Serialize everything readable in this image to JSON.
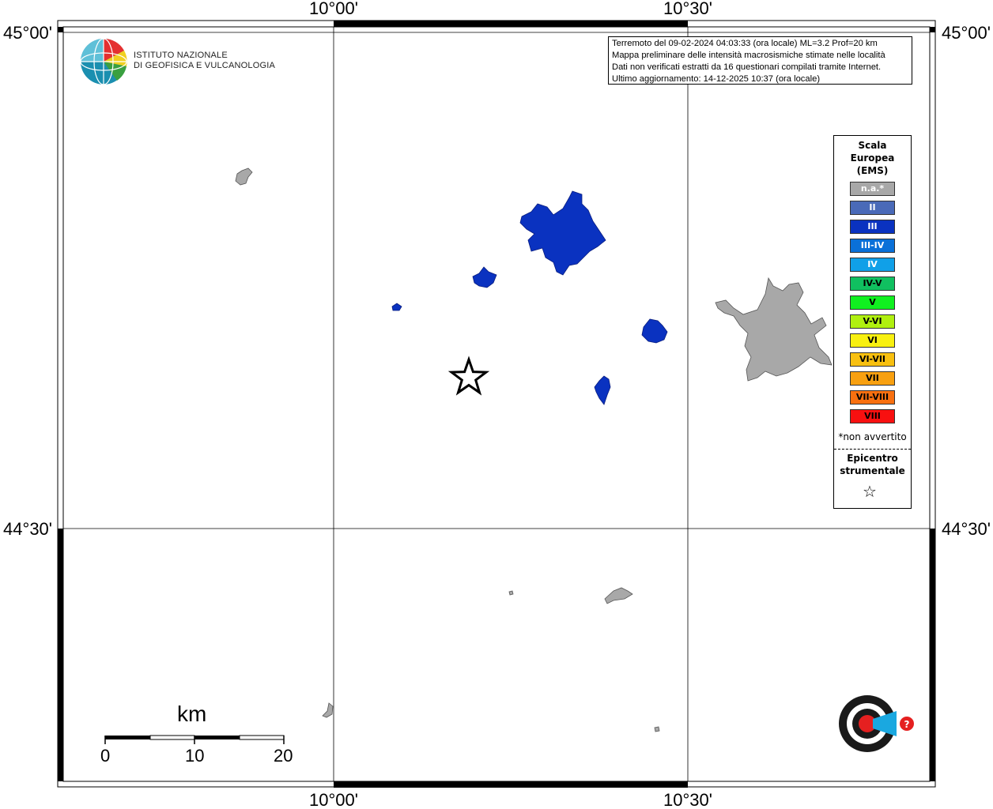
{
  "map": {
    "lon_labels": [
      "10°00'",
      "10°30'"
    ],
    "lat_labels": [
      "45°00'",
      "44°30'"
    ]
  },
  "logo": {
    "line1": "ISTITUTO NAZIONALE",
    "line2": "DI GEOFISICA E VULCANOLOGIA"
  },
  "info": {
    "line1": "Terremoto del 09-02-2024 04:03:33 (ora locale) ML=3.2 Prof=20 km",
    "line2": "Mappa preliminare delle intensità macrosismiche stimate nelle località",
    "line3": "Dati non verificati estratti da 16 questionari compilati tramite Internet.",
    "line4": "Ultimo aggiornamento: 14-12-2025 10:37 (ora locale)"
  },
  "legend": {
    "title1": "Scala",
    "title2": "Europea",
    "title3": "(EMS)",
    "items": [
      {
        "label": "n.a.*",
        "color": "#a8a8a8",
        "text_color": "#ffffff"
      },
      {
        "label": "II",
        "color": "#4a6ab8",
        "text_color": "#ffffff"
      },
      {
        "label": "III",
        "color": "#0a32c0",
        "text_color": "#ffffff"
      },
      {
        "label": "III-IV",
        "color": "#0a70d8",
        "text_color": "#ffffff"
      },
      {
        "label": "IV",
        "color": "#10a0e8",
        "text_color": "#ffffff"
      },
      {
        "label": "IV-V",
        "color": "#10c060",
        "text_color": "#000000"
      },
      {
        "label": "V",
        "color": "#10f020",
        "text_color": "#000000"
      },
      {
        "label": "V-VI",
        "color": "#b0f010",
        "text_color": "#000000"
      },
      {
        "label": "VI",
        "color": "#f8f010",
        "text_color": "#000000"
      },
      {
        "label": "VI-VII",
        "color": "#f8c010",
        "text_color": "#000000"
      },
      {
        "label": "VII",
        "color": "#f8a010",
        "text_color": "#000000"
      },
      {
        "label": "VII-VIII",
        "color": "#f87010",
        "text_color": "#000000"
      },
      {
        "label": "VIII",
        "color": "#f81010",
        "text_color": "#000000"
      }
    ],
    "note": "*non avvertito",
    "epi1": "Epicentro",
    "epi2": "strumentale",
    "star": "☆"
  },
  "scale": {
    "unit": "km",
    "ticks": [
      "0",
      "10",
      "20"
    ]
  },
  "colors": {
    "intensity_III": "#0a32c0",
    "not_felt": "#a8a8a8"
  }
}
